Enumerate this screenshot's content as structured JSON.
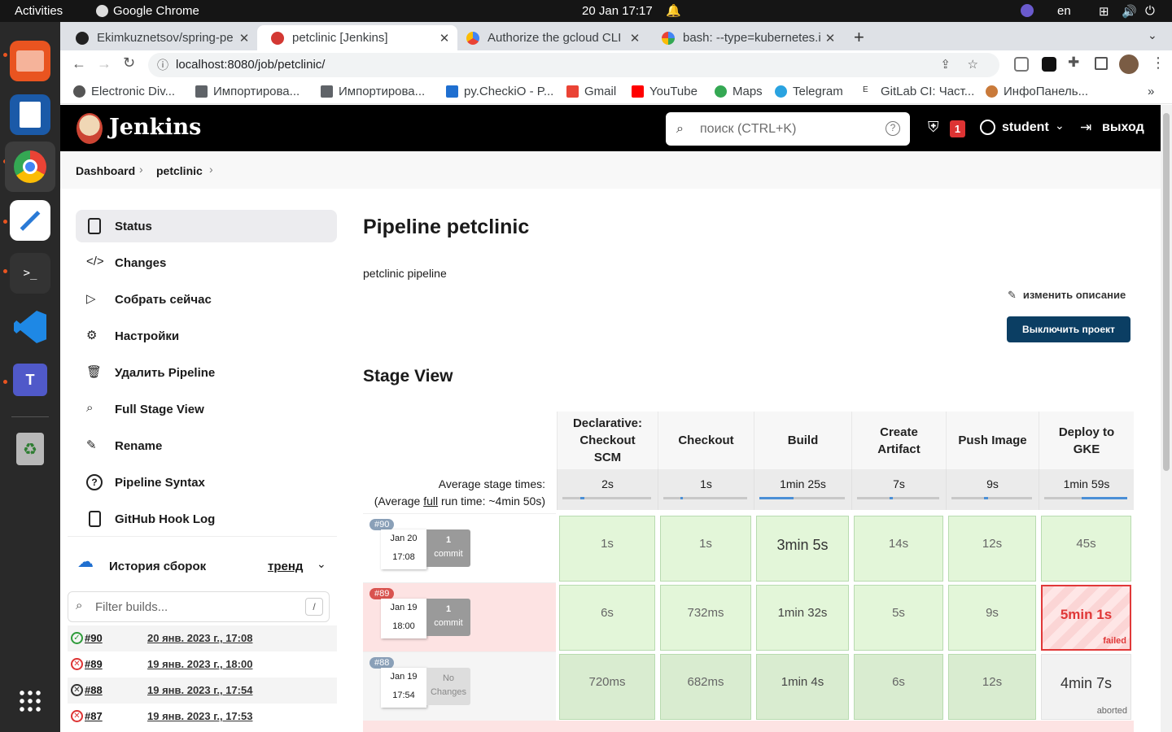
{
  "system": {
    "activities": "Activities",
    "app": "Google Chrome",
    "clock": "20 Jan  17:17",
    "lang": "en"
  },
  "tabs": [
    {
      "title": "Ekimkuznetsov/spring-pe",
      "active": false
    },
    {
      "title": "petclinic [Jenkins]",
      "active": true
    },
    {
      "title": "Authorize the gcloud CLI",
      "active": false
    },
    {
      "title": "bash: --type=kubernetes.i",
      "active": false
    }
  ],
  "address": "localhost:8080/job/petclinic/",
  "bookmarks": [
    "Electronic Div...",
    "Импортирова...",
    "Импортирова...",
    "py.CheckiO - P...",
    "Gmail",
    "YouTube",
    "Maps",
    "Telegram",
    "GitLab CI: Част...",
    "ИнфоПанель..."
  ],
  "jenkins": {
    "logo": "Jenkins",
    "search_placeholder": "поиск (CTRL+K)",
    "alert_count": "1",
    "user": "student",
    "logout": "выход",
    "breadcrumb": [
      "Dashboard",
      "petclinic"
    ],
    "sidebar": [
      "Status",
      "Changes",
      "Собрать сейчас",
      "Настройки",
      "Удалить Pipeline",
      "Full Stage View",
      "Rename",
      "Pipeline Syntax",
      "GitHub Hook Log"
    ],
    "history": {
      "title": "История сборок",
      "trend": "тренд",
      "filter_placeholder": "Filter builds...",
      "filter_key": "/",
      "builds": [
        {
          "num": "#90",
          "date": "20 янв. 2023 г., 17:08",
          "status": "success"
        },
        {
          "num": "#89",
          "date": "19 янв. 2023 г., 18:00",
          "status": "failed"
        },
        {
          "num": "#88",
          "date": "19 янв. 2023 г., 17:54",
          "status": "aborted"
        },
        {
          "num": "#87",
          "date": "19 янв. 2023 г., 17:53",
          "status": "failed"
        }
      ]
    },
    "title": "Pipeline petclinic",
    "description": "petclinic pipeline",
    "edit_description": "изменить описание",
    "disable_button": "Выключить проект",
    "stage_view": {
      "heading": "Stage View",
      "avg_label": "Average stage times:",
      "avg_run_prefix": "(Average ",
      "avg_run_word": "full",
      "avg_run_suffix": " run time: ~4min 50s)",
      "stages": [
        "Declarative: Checkout SCM",
        "Checkout",
        "Build",
        "Create Artifact",
        "Push Image",
        "Deploy to GKE"
      ],
      "averages": [
        "2s",
        "1s",
        "1min 25s",
        "7s",
        "9s",
        "1min 59s"
      ],
      "avg_fill": [
        0.05,
        0.03,
        0.4,
        0.04,
        0.05,
        0.55
      ],
      "runs": [
        {
          "num": "#90",
          "date": "Jan 20",
          "time": "17:08",
          "changes": "1",
          "changes_label": "commit",
          "status": "success",
          "cells": [
            "1s",
            "1s",
            "3min 5s",
            "14s",
            "12s",
            "45s"
          ]
        },
        {
          "num": "#89",
          "date": "Jan 19",
          "time": "18:00",
          "changes": "1",
          "changes_label": "commit",
          "status": "failed",
          "cells": [
            "6s",
            "732ms",
            "1min 32s",
            "5s",
            "9s",
            "5min 1s"
          ],
          "last_note": "failed"
        },
        {
          "num": "#88",
          "date": "Jan 19",
          "time": "17:54",
          "changes": "No",
          "changes_label": "Changes",
          "status": "aborted",
          "cells": [
            "720ms",
            "682ms",
            "1min 4s",
            "6s",
            "12s",
            "4min 7s"
          ],
          "last_note": "aborted"
        }
      ]
    }
  }
}
